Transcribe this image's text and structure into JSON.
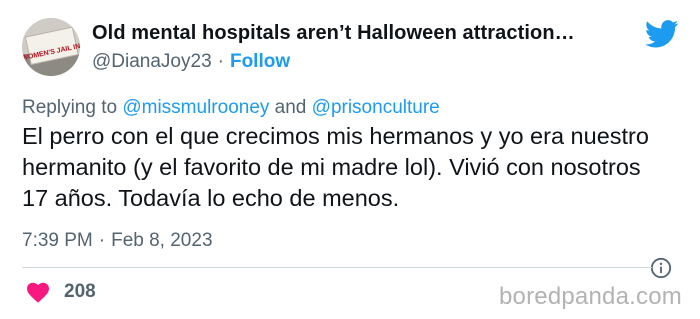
{
  "tweet": {
    "display_name": "Old mental hospitals aren’t Halloween attraction…",
    "handle": "@DianaJoy23",
    "separator": "·",
    "follow_label": "Follow",
    "avatar_sign_text": "NO WOMEN'S JAIL IN NYC",
    "replying_prefix": "Replying to",
    "reply_mentions": [
      "@missmulrooney",
      "@prisonculture"
    ],
    "reply_joiner": "and",
    "text": "El perro con el que crecimos mis hermanos y yo era nuestro hermanito (y el favorito de mi madre lol). Vivió con nosotros 17 años. Todavía lo echo de menos.",
    "time": "7:39 PM",
    "date": "Feb 8, 2023",
    "likes": "208"
  },
  "watermark": "boredpanda.com",
  "colors": {
    "accent": "#1d9bf0",
    "heart": "#f91880",
    "secondary_text": "#536471",
    "primary_text": "#0f1419",
    "divider": "#cfd9de"
  },
  "icons": {
    "logo": "twitter-bird-icon",
    "info": "info-circle-icon",
    "like": "heart-icon"
  }
}
